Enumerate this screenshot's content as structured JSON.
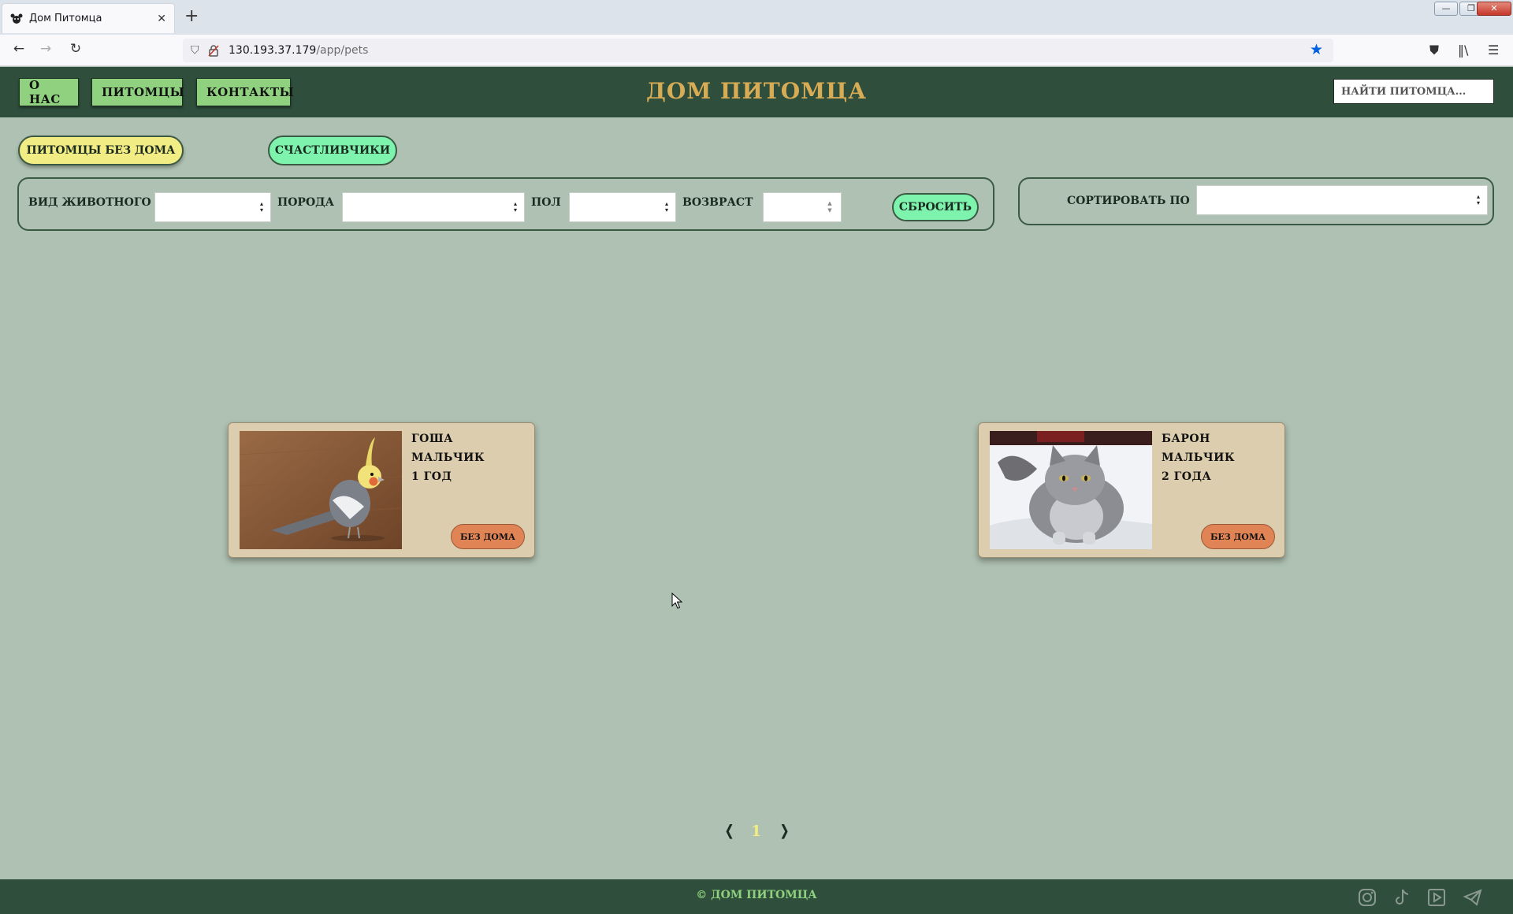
{
  "browser": {
    "tab_title": "Дом Питомца",
    "tab_close": "✕",
    "new_tab": "+",
    "url_host": "130.193.37.179",
    "url_path": "/app/pets",
    "back": "←",
    "forward": "→",
    "reload": "↻",
    "minimize": "—",
    "restore": "❐",
    "close": "✕"
  },
  "header": {
    "nav": [
      "О НАС",
      "ПИТОМЦЫ",
      "КОНТАКТЫ"
    ],
    "logo": "ДОМ ПИТОМЦА",
    "search_placeholder": "НАЙТИ ПИТОМЦА..."
  },
  "tabs": {
    "homeless": "ПИТОМЦЫ БЕЗ ДОМА",
    "lucky": "СЧАСТЛИВЧИКИ",
    "active": "homeless"
  },
  "filters": {
    "species_label": "ВИД ЖИВОТНОГО",
    "breed_label": "ПОРОДА",
    "sex_label": "ПОЛ",
    "age_label": "ВОЗВРАСТ",
    "reset": "СБРОСИТЬ",
    "sort_label": "СОРТИРОВАТЬ ПО"
  },
  "pets": [
    {
      "name": "ГОША",
      "sex": "МАЛЬЧИК",
      "age": "1 ГОД",
      "status": "БЕЗ ДОМА",
      "photo": "cockatiel-photo"
    },
    {
      "name": "БАРОН",
      "sex": "МАЛЬЧИК",
      "age": "2 ГОДА",
      "status": "БЕЗ ДОМА",
      "photo": "cat-photo"
    }
  ],
  "pagination": {
    "prev": "❬",
    "current": "1",
    "next": "❭"
  },
  "footer": {
    "copyright": "© ДОМ ПИТОМЦА",
    "social": [
      "instagram-icon",
      "tiktok-icon",
      "youtube-icon",
      "telegram-icon"
    ]
  },
  "colors": {
    "page_bg": "#afc1b2",
    "header_bg": "#2f4f3c",
    "accent_green": "#8fd17f",
    "logo_gold": "#d8ac55",
    "active_tab": "#f2ec85",
    "mint": "#7ef3ad",
    "card_bg": "#dbcdae",
    "status_orange": "#e08456"
  }
}
